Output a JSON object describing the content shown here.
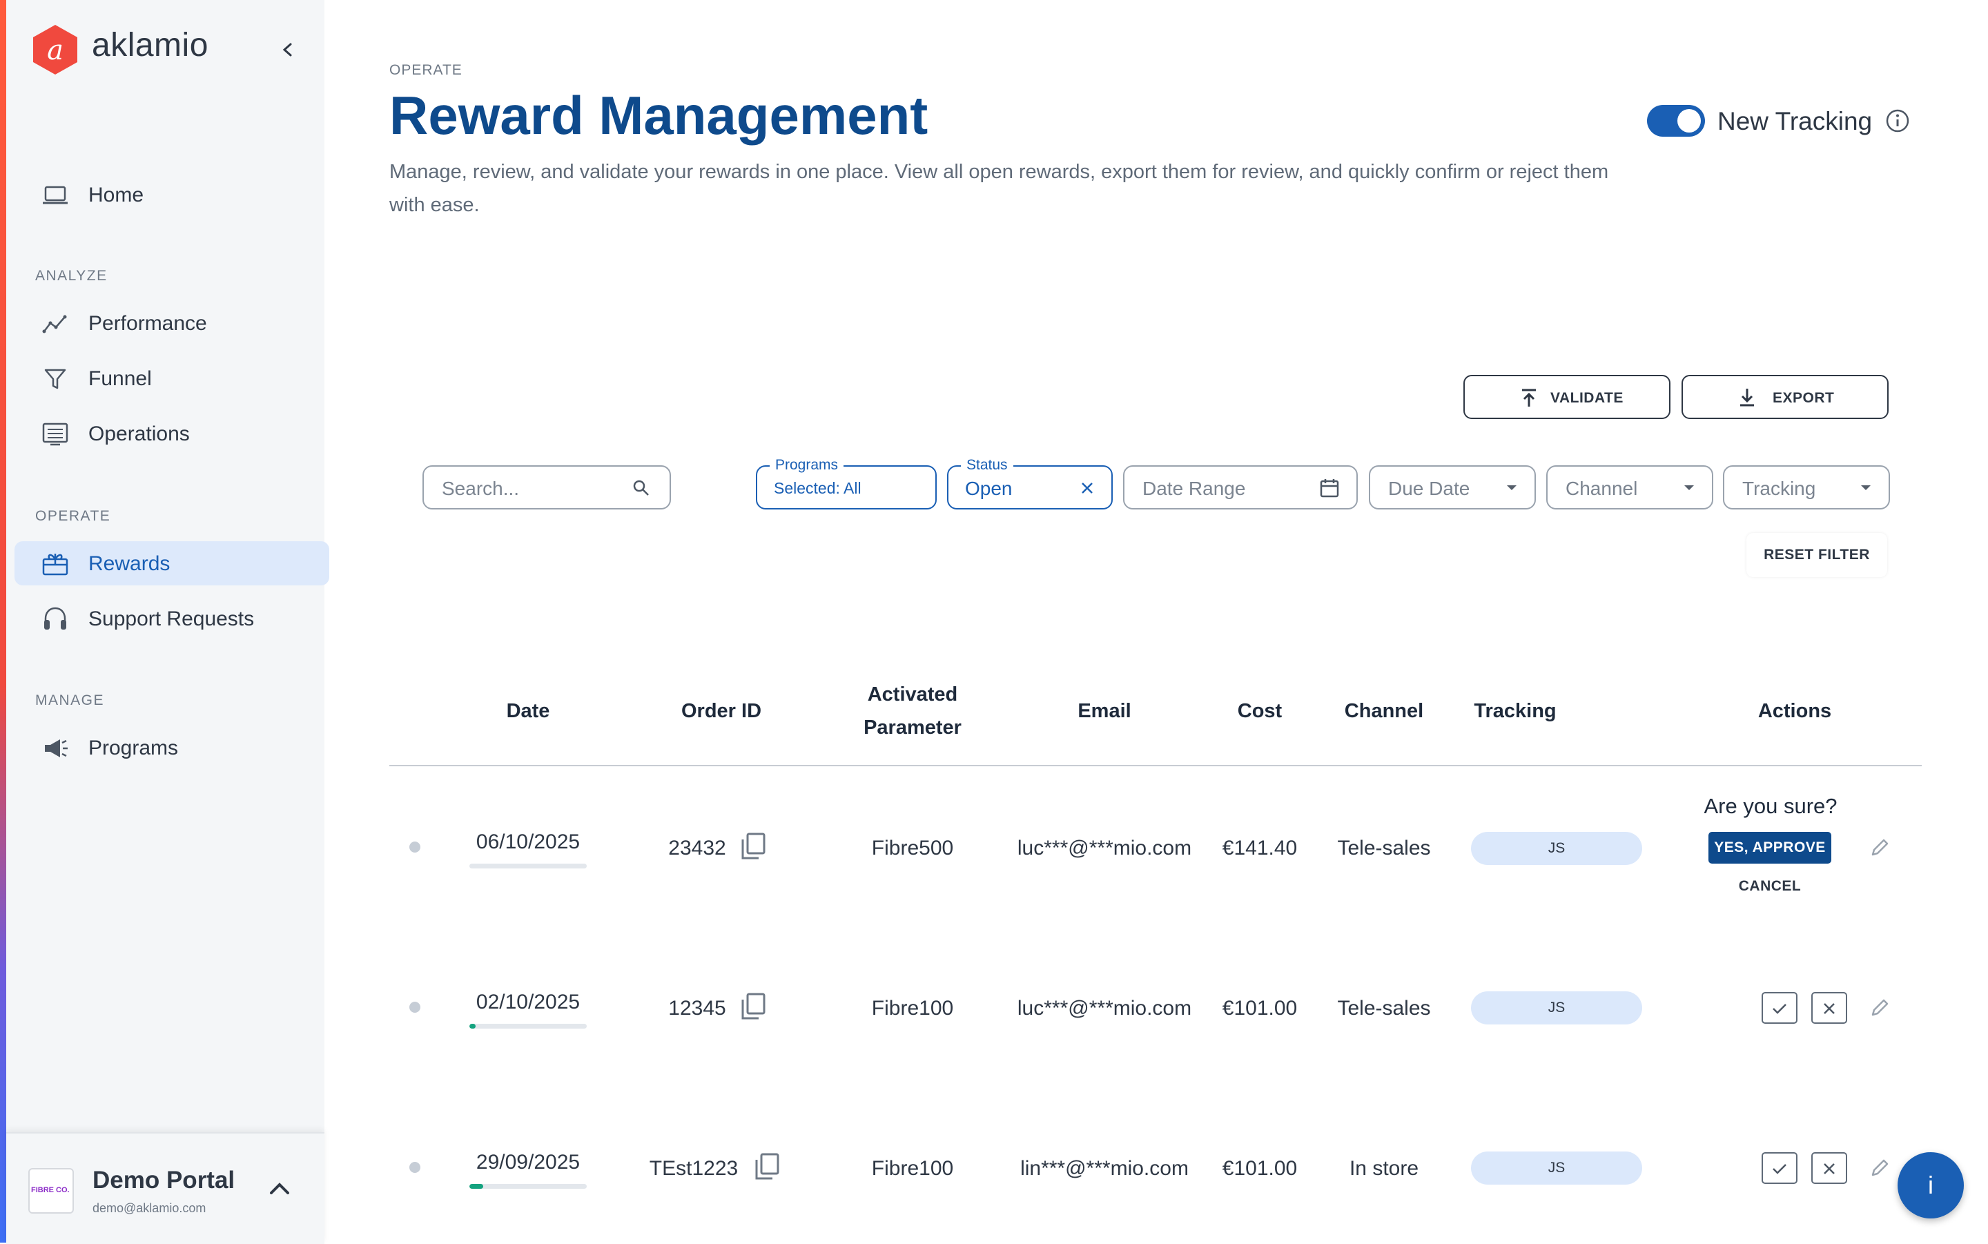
{
  "app": {
    "brand": "aklamio"
  },
  "sidebar": {
    "sections": {
      "analyze": "ANALYZE",
      "operate": "OPERATE",
      "manage": "MANAGE"
    },
    "items": [
      {
        "label": "Home",
        "icon": "laptop-icon"
      },
      {
        "label": "Performance",
        "icon": "chart-icon"
      },
      {
        "label": "Funnel",
        "icon": "funnel-icon"
      },
      {
        "label": "Operations",
        "icon": "list-icon"
      },
      {
        "label": "Rewards",
        "icon": "gift-icon",
        "active": true
      },
      {
        "label": "Support Requests",
        "icon": "headset-icon"
      },
      {
        "label": "Programs",
        "icon": "megaphone-icon"
      }
    ],
    "portal": {
      "name": "Demo Portal",
      "email": "demo@aklamio.com",
      "logo_text": "FIBRE CO."
    }
  },
  "header": {
    "eyebrow": "OPERATE",
    "title": "Reward Management",
    "description": "Manage, review, and validate your rewards in one place. View all open rewards, export them for review, and quickly confirm or reject them with ease.",
    "toggle": {
      "label": "New Tracking",
      "on": true
    }
  },
  "actions": {
    "validate": "VALIDATE",
    "export": "EXPORT",
    "reset": "RESET FILTER"
  },
  "filters": {
    "search_placeholder": "Search...",
    "programs": {
      "legend": "Programs",
      "value": "Selected: All"
    },
    "status": {
      "legend": "Status",
      "value": "Open"
    },
    "date_range": "Date Range",
    "due_date": "Due Date",
    "channel": "Channel",
    "tracking": "Tracking"
  },
  "table": {
    "columns": [
      "Date",
      "Order ID",
      "Activated Parameter",
      "Email",
      "Cost",
      "Channel",
      "Tracking",
      "Actions"
    ],
    "rows": [
      {
        "date": "06/10/2025",
        "progress": 0,
        "order_id": "23432",
        "param": "Fibre500",
        "email": "luc***@***mio.com",
        "cost": "€141.40",
        "channel": "Tele-sales",
        "tracking": "JS",
        "confirming": true
      },
      {
        "date": "02/10/2025",
        "progress": 0.05,
        "order_id": "12345",
        "param": "Fibre100",
        "email": "luc***@***mio.com",
        "cost": "€101.00",
        "channel": "Tele-sales",
        "tracking": "JS",
        "confirming": false
      },
      {
        "date": "29/09/2025",
        "progress": 0.12,
        "order_id": "TEst1223",
        "param": "Fibre100",
        "email": "lin***@***mio.com",
        "cost": "€101.00",
        "channel": "In store",
        "tracking": "JS",
        "confirming": false
      }
    ],
    "confirm": {
      "question": "Are you sure?",
      "approve": "YES, APPROVE",
      "cancel": "CANCEL"
    }
  },
  "fab": {
    "label": "i"
  },
  "colors": {
    "primary": "#1a5fb4",
    "title": "#0e4a8c",
    "brand": "#f0493e",
    "success": "#14a37f"
  }
}
